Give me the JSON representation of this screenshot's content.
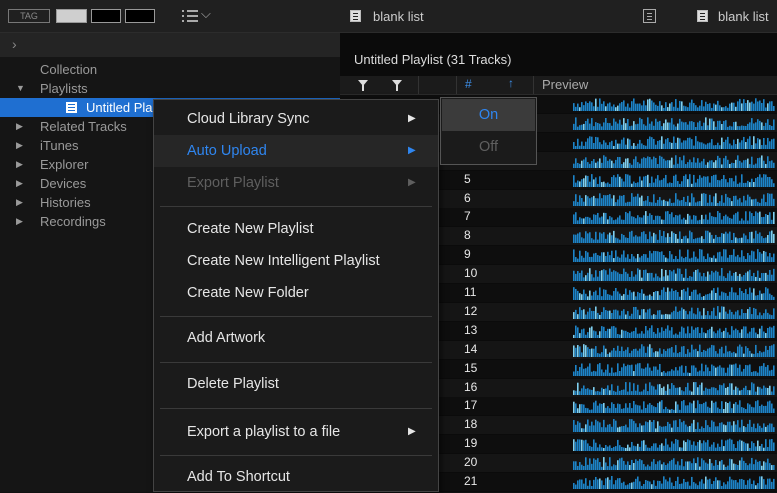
{
  "toolbar": {
    "tag_label": "TAG",
    "swatches": [
      "#cfcfcf",
      "#000000",
      "#000000"
    ]
  },
  "tree": {
    "collection": "Collection",
    "playlists": "Playlists",
    "untitled": "Untitled Pla",
    "related": "Related Tracks",
    "itunes": "iTunes",
    "explorer": "Explorer",
    "devices": "Devices",
    "histories": "Histories",
    "recordings": "Recordings"
  },
  "tabs": {
    "left_label": "blank list",
    "right_label": "blank list"
  },
  "playlist": {
    "title": "Untitled Playlist (31 Tracks)",
    "col_number": "#",
    "col_preview": "Preview",
    "row_numbers": [
      "",
      "",
      "",
      "",
      "5",
      "6",
      "7",
      "8",
      "9",
      "10",
      "11",
      "12",
      "13",
      "14",
      "15",
      "16",
      "17",
      "18",
      "19",
      "20",
      "21"
    ]
  },
  "context_menu": {
    "cloud_sync": "Cloud Library Sync",
    "auto_upload": "Auto Upload",
    "export_playlist": "Export Playlist",
    "create_playlist": "Create New Playlist",
    "create_intelligent": "Create New Intelligent Playlist",
    "create_folder": "Create New Folder",
    "add_artwork": "Add Artwork",
    "delete_playlist": "Delete Playlist",
    "export_file": "Export a playlist to a file",
    "add_shortcut": "Add To Shortcut"
  },
  "submenu": {
    "on": "On",
    "off": "Off"
  },
  "colors": {
    "accent": "#2f86f0",
    "selection": "#1f6fd1",
    "waveform": "#1d84c8"
  }
}
